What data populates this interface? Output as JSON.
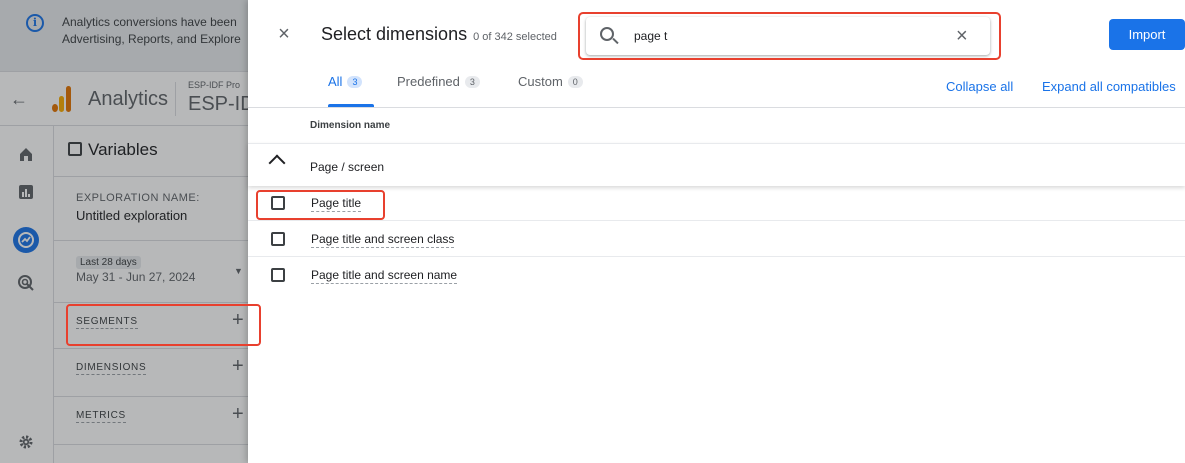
{
  "banner": {
    "icon": "info-icon",
    "line1": "Analytics conversions have been",
    "line2": "Advertising, Reports, and Explore"
  },
  "topbar": {
    "back_icon": "back-arrow-icon",
    "app_name": "Analytics",
    "property_small": "ESP-IDF Pro",
    "property_big": "ESP-ID"
  },
  "leftnav": {
    "items": [
      {
        "icon": "home-icon"
      },
      {
        "icon": "reports-icon"
      },
      {
        "icon": "explore-icon"
      },
      {
        "icon": "advertising-icon"
      }
    ],
    "settings_icon": "gear-icon"
  },
  "variables": {
    "header": "Variables",
    "exploration_label": "EXPLORATION NAME:",
    "exploration_value": "Untitled exploration",
    "date_label": "Last 28 days",
    "date_value": "May 31 - Jun 27, 2024",
    "sections": [
      {
        "label": "SEGMENTS",
        "add": "+"
      },
      {
        "label": "DIMENSIONS",
        "add": "+"
      },
      {
        "label": "METRICS",
        "add": "+"
      }
    ]
  },
  "dialog": {
    "close": "×",
    "title": "Select dimensions",
    "count": "0 of 342 selected",
    "search": {
      "value": "page t",
      "placeholder": "",
      "clear": "×"
    },
    "import_label": "Import",
    "tabs": [
      {
        "label": "All",
        "count": "3"
      },
      {
        "label": "Predefined",
        "count": "3"
      },
      {
        "label": "Custom",
        "count": "0"
      }
    ],
    "collapse_all": "Collapse all",
    "expand_all": "Expand all compatibles",
    "column_header": "Dimension name",
    "group_label": "Page / screen",
    "rows": [
      {
        "label": "Page title"
      },
      {
        "label": "Page title and screen class"
      },
      {
        "label": "Page title and screen name"
      }
    ]
  },
  "colors": {
    "accent": "#1a73e8",
    "highlight": "#e8402e"
  }
}
